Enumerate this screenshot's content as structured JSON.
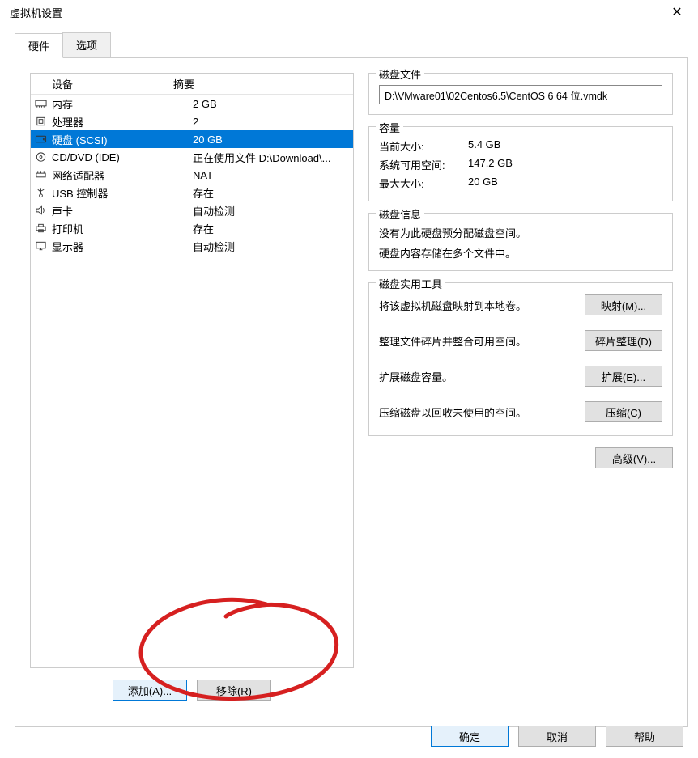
{
  "window": {
    "title": "虚拟机设置",
    "close_icon": "✕"
  },
  "tabs": {
    "hardware": "硬件",
    "options": "选项"
  },
  "list_header": {
    "device": "设备",
    "summary": "摘要"
  },
  "devices": [
    {
      "name": "内存",
      "summary": "2 GB",
      "icon": "memory"
    },
    {
      "name": "处理器",
      "summary": "2",
      "icon": "cpu"
    },
    {
      "name": "硬盘 (SCSI)",
      "summary": "20 GB",
      "icon": "disk",
      "selected": true
    },
    {
      "name": "CD/DVD (IDE)",
      "summary": "正在使用文件 D:\\Download\\...",
      "icon": "cd"
    },
    {
      "name": "网络适配器",
      "summary": "NAT",
      "icon": "network"
    },
    {
      "name": "USB 控制器",
      "summary": "存在",
      "icon": "usb"
    },
    {
      "name": "声卡",
      "summary": "自动检测",
      "icon": "sound"
    },
    {
      "name": "打印机",
      "summary": "存在",
      "icon": "printer"
    },
    {
      "name": "显示器",
      "summary": "自动检测",
      "icon": "display"
    }
  ],
  "buttons": {
    "add": "添加(A)...",
    "remove": "移除(R)"
  },
  "groups": {
    "diskfile": {
      "title": "磁盘文件",
      "path": "D:\\VMware01\\02Centos6.5\\CentOS 6 64 位.vmdk"
    },
    "capacity": {
      "title": "容量",
      "current_label": "当前大小:",
      "current_value": "5.4 GB",
      "free_label": "系统可用空间:",
      "free_value": "147.2 GB",
      "max_label": "最大大小:",
      "max_value": "20 GB"
    },
    "diskinfo": {
      "title": "磁盘信息",
      "line1": "没有为此硬盘预分配磁盘空间。",
      "line2": "硬盘内容存储在多个文件中。"
    },
    "utilities": {
      "title": "磁盘实用工具",
      "map_desc": "将该虚拟机磁盘映射到本地卷。",
      "map_btn": "映射(M)...",
      "defrag_desc": "整理文件碎片并整合可用空间。",
      "defrag_btn": "碎片整理(D)",
      "expand_desc": "扩展磁盘容量。",
      "expand_btn": "扩展(E)...",
      "compact_desc": "压缩磁盘以回收未使用的空间。",
      "compact_btn": "压缩(C)"
    },
    "advanced": "高级(V)..."
  },
  "footer": {
    "ok": "确定",
    "cancel": "取消",
    "help": "帮助"
  }
}
